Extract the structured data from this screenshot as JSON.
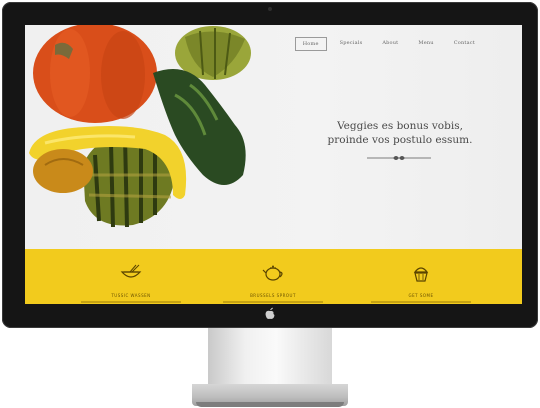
{
  "nav": {
    "items": [
      {
        "label": "Home",
        "active": true
      },
      {
        "label": "Specials",
        "active": false
      },
      {
        "label": "About",
        "active": false
      },
      {
        "label": "Menu",
        "active": false
      },
      {
        "label": "Contact",
        "active": false
      }
    ]
  },
  "hero": {
    "headline_line1": "Veggies es bonus vobis,",
    "headline_line2": "proinde vos postulo essum."
  },
  "features": [
    {
      "title": "TUSSIC WASSEN",
      "icon": "bowl-icon"
    },
    {
      "title": "BRUSSELS SPROUT",
      "icon": "teapot-icon"
    },
    {
      "title": "GET SOME",
      "icon": "cupcake-icon"
    }
  ],
  "colors": {
    "band": "#f2cb1d",
    "bezel": "#151515"
  }
}
